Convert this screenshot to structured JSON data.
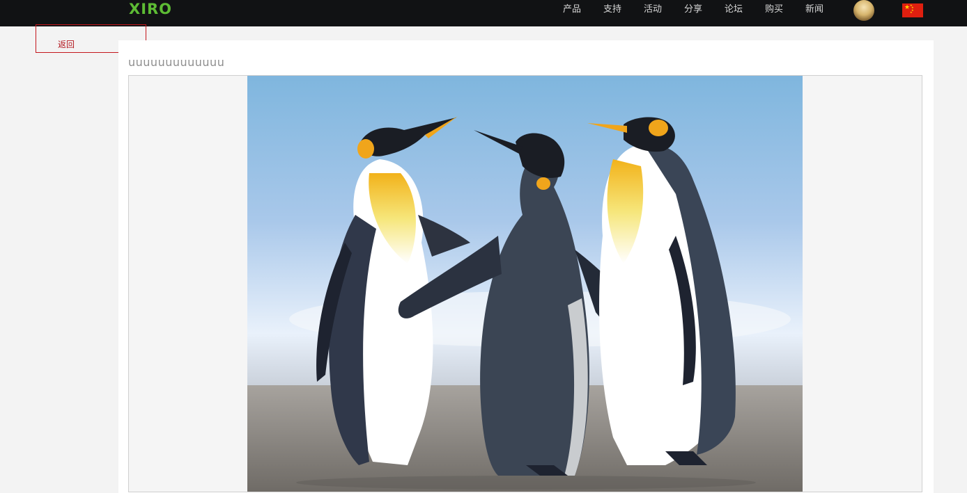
{
  "header": {
    "logo_text": "XIRO",
    "nav": [
      {
        "label": "产品"
      },
      {
        "label": "支持"
      },
      {
        "label": "活动"
      },
      {
        "label": "分享"
      },
      {
        "label": "论坛"
      },
      {
        "label": "购买"
      },
      {
        "label": "新闻"
      }
    ],
    "flag_icon": "china-flag-icon",
    "avatar_icon": "user-avatar"
  },
  "back": {
    "label": "返回"
  },
  "post": {
    "title": "uuuuuuuuuuuuu",
    "image_subject": "penguins"
  },
  "colors": {
    "topbar": "#111214",
    "logo": "#5dbb34",
    "back_border": "#c4161c",
    "page_bg": "#f3f3f3"
  }
}
